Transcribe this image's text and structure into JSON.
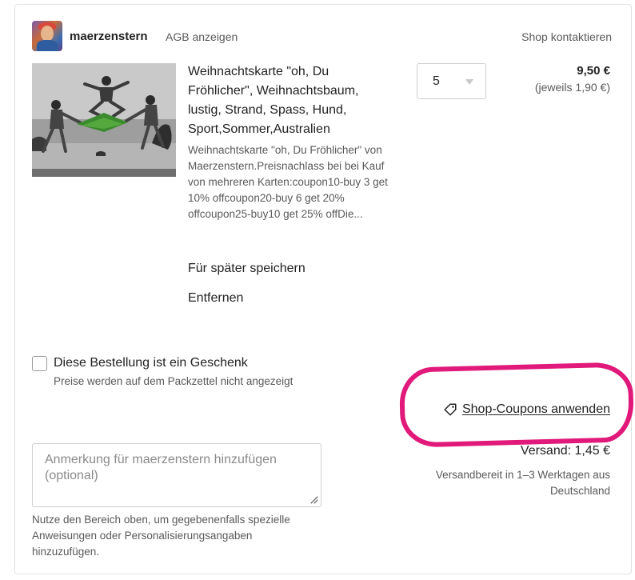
{
  "shop": {
    "name": "maerzenstern",
    "agb_link": "AGB anzeigen",
    "contact_link": "Shop kontaktieren"
  },
  "item": {
    "title": "Weihnachtskarte \"oh, Du Fröhlicher\", Weihnachtsbaum, lustig, Strand, Spass, Hund, Sport,Sommer,Australien",
    "description": "Weihnachtskarte \"oh, Du Fröhlicher\" von Maerzenstern.Preisnachlass bei bei Kauf von mehreren Karten:coupon10-buy 3 get 10% offcoupon20-buy 6 get 20% offcoupon25-buy10 get 25% offDie...",
    "quantity": "5",
    "price": "9,50 €",
    "unit_price": "(jeweils 1,90 €)",
    "save_for_later": "Für später speichern",
    "remove": "Entfernen"
  },
  "gift": {
    "label": "Diese Bestellung ist ein Geschenk",
    "note": "Preise werden auf dem Packzettel nicht angezeigt"
  },
  "coupon": {
    "label": "Shop-Coupons anwenden"
  },
  "shipping": {
    "cost": "Versand: 1,45 €",
    "ready": "Versandbereit in 1–3 Werktagen aus Deutschland"
  },
  "note": {
    "placeholder": "Anmerkung für maerzenstern hinzufügen (optional)",
    "help": "Nutze den Bereich oben, um gegebenenfalls spezielle Anweisungen oder Personalisierungsangaben hinzuzufügen."
  },
  "colors": {
    "annotation": "#e0197a",
    "text_primary": "#222222",
    "text_secondary": "#595959",
    "border": "#cfcfcf"
  }
}
